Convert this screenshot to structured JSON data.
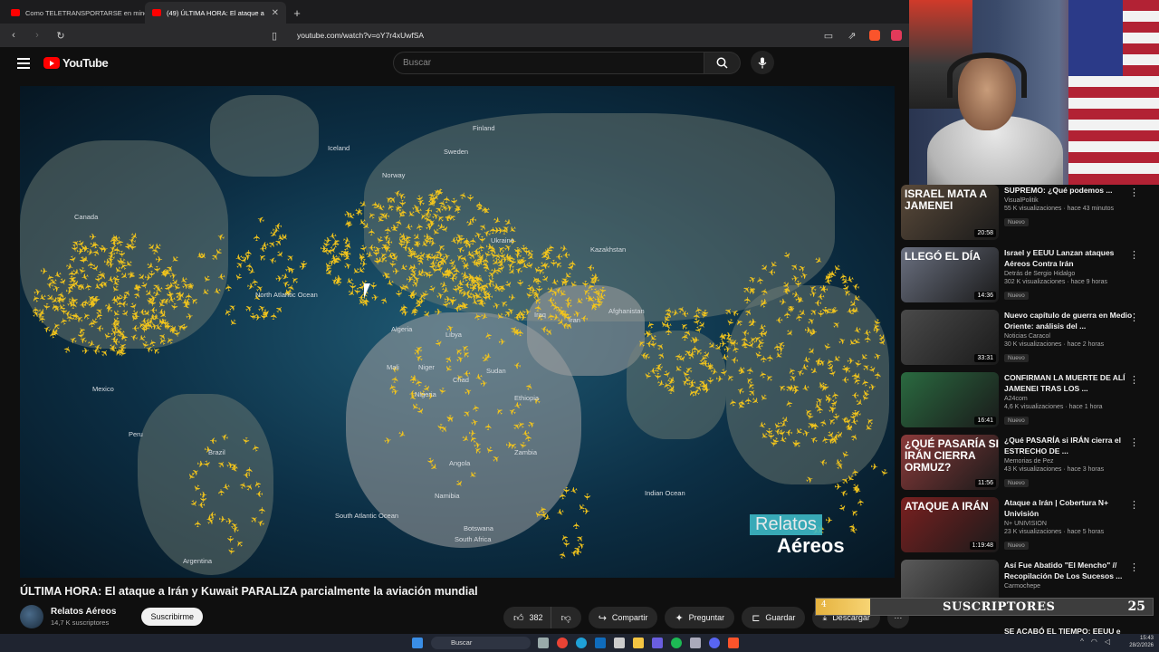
{
  "browser": {
    "tabs": [
      {
        "label": "Como TELETRANSPORTARSE en minecra"
      },
      {
        "label": "(49) ÚLTIMA HORA: El ataque a"
      }
    ],
    "new_tab": "+",
    "url": "youtube.com/watch?v=oY7r4xUwfSA"
  },
  "youtube": {
    "logo_text": "YouTube",
    "search_placeholder": "Buscar"
  },
  "video": {
    "title": "ÚLTIMA HORA: El ataque a Irán y Kuwait PARALIZA parcialmente la aviación mundial",
    "channel": "Relatos Aéreos",
    "subscribers": "14,7 K suscriptores",
    "subscribe_label": "Suscribirme",
    "likes": "382",
    "share_label": "Compartir",
    "ask_label": "Preguntar",
    "save_label": "Guardar",
    "download_label": "Descargar",
    "more_label": "···",
    "watermark_line1": "Relatos",
    "watermark_line2": "Aéreos",
    "map_labels": [
      "Iceland",
      "Sweden",
      "Finland",
      "Norway",
      "Ukraine",
      "Kazakhstan",
      "Libya",
      "Algeria",
      "Mali",
      "Niger",
      "Chad",
      "Sudan",
      "Nigeria",
      "Ethiopia",
      "Angola",
      "Zambia",
      "Namibia",
      "Botswana",
      "South Africa",
      "Iraq",
      "Iran",
      "Afghanistan",
      "Brazil",
      "Peru",
      "Argentina",
      "South Atlantic Ocean",
      "Indian Ocean",
      "North Atlantic Ocean",
      "Canada",
      "Mexico"
    ]
  },
  "sidebar": {
    "items": [
      {
        "title": "SUPREMO: ¿Qué podemos ...",
        "channel": "VisualPolitik",
        "stats": "55 K visualizaciones · hace 43 minutos",
        "badge": "Nuevo",
        "duration": "20:58",
        "thumb_text": "ISRAEL MATA A JAMENEI",
        "thumb_color": "#5a4a3a"
      },
      {
        "title": "Israel y EEUU Lanzan ataques Aéreos Contra Irán",
        "channel": "Detrás de Sergio Hidalgo",
        "stats": "302 K visualizaciones · hace 9 horas",
        "badge": "Nuevo",
        "duration": "14:36",
        "thumb_text": "LLEGÓ EL DÍA",
        "thumb_color": "#6a7080"
      },
      {
        "title": "Nuevo capítulo de guerra en Medio Oriente: análisis del ...",
        "channel": "Noticias Caracol",
        "stats": "30 K visualizaciones · hace 2 horas",
        "badge": "Nuevo",
        "duration": "33:31",
        "thumb_text": "",
        "thumb_color": "#4a4a4a"
      },
      {
        "title": "CONFIRMAN LA MUERTE DE ALÍ JAMENEI TRAS LOS ...",
        "channel": "A24com",
        "stats": "4,6 K visualizaciones · hace 1 hora",
        "badge": "Nuevo",
        "duration": "16:41",
        "thumb_text": "",
        "thumb_color": "#2a6a40"
      },
      {
        "title": "¿Qué PASARÍA si IRÁN cierra el ESTRECHO DE ...",
        "channel": "Memorias de Pez",
        "stats": "43 K visualizaciones · hace 3 horas",
        "badge": "Nuevo",
        "duration": "11:56",
        "thumb_text": "¿QUÉ PASARÍA SI IRÁN CIERRA ORMUZ?",
        "thumb_color": "#8a3a3a"
      },
      {
        "title": "Ataque a Irán | Cobertura N+ Univisión",
        "channel": "N+ UNIVISION",
        "stats": "23 K visualizaciones · hace 5 horas",
        "badge": "Nuevo",
        "duration": "1:19:48",
        "thumb_text": "ATAQUE A IRÁN",
        "thumb_color": "#7a2020"
      },
      {
        "title": "Así Fue Abatido \"El Mencho\" // Recopilación De Los Sucesos ...",
        "channel": "Carmochepe",
        "stats": "",
        "badge": "",
        "duration": "",
        "thumb_text": "",
        "thumb_color": "#5a5a5a"
      }
    ],
    "peek_title": "SE ACABÓ EL TIEMPO: EEUU e"
  },
  "overlay": {
    "sub_current": "4",
    "sub_label": "SUSCRIPTORES",
    "sub_goal": "25",
    "sub_progress": 0.16
  },
  "taskbar": {
    "search_label": "Buscar",
    "time": "15:43",
    "date": "28/2/2026"
  },
  "colors": {
    "accent_red": "#ff0000",
    "plane_yellow": "#f3c51c",
    "bg": "#0f0f0f"
  }
}
